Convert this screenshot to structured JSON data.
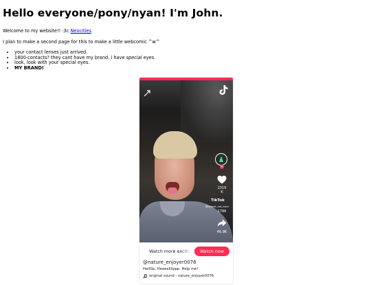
{
  "header": {
    "title": "Hello everyone/pony/nyan! I'm John."
  },
  "intro": {
    "welcome_prefix": "Welcome to my website!! :3c ",
    "welcome_link": "Neocities",
    "welcome_suffix": ".",
    "plan": "I plan to make a second page for this to make a little webcomic ^w^"
  },
  "list": {
    "item1": "your contact lenses just arrived.",
    "item2_prefix": "1800-contacts? they cant have my brand. i have ",
    "item2_em": "special",
    "item2_suffix": " eyes.",
    "item3": "look, look with your special eyes.",
    "item4": "MY BRAND!"
  },
  "tiktok": {
    "like_count": "2319",
    "like_unit": "K",
    "brand_mini": "TikTok",
    "username_mini": "@largest_nat_lover",
    "comment_count": "1786",
    "share_count": "46.9K",
    "watch_more": "Watch more exciting videos",
    "watch_now": "Watch now",
    "author": "@nature_enjoyer0076",
    "caption": "Helllllp. Heeeellllppp. Help me!",
    "sound": "original sound - nature_enjoyer0076"
  },
  "colors": {
    "tiktok_accent": "#fe2c55",
    "link": "#0000ee"
  }
}
